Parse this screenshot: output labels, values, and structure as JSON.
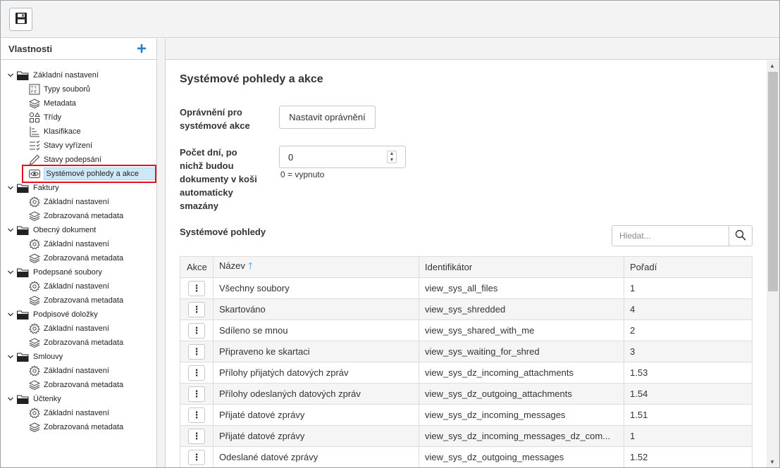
{
  "sidebar": {
    "title": "Vlastnosti",
    "groups": [
      {
        "label": "Základní nastavení",
        "items": [
          {
            "label": "Typy souborů",
            "icon": "file-types-icon"
          },
          {
            "label": "Metadata",
            "icon": "layers-icon"
          },
          {
            "label": "Třídy",
            "icon": "shapes-icon"
          },
          {
            "label": "Klasifikace",
            "icon": "classification-icon"
          },
          {
            "label": "Stavy vyřízení",
            "icon": "checklist-icon"
          },
          {
            "label": "Stavy podepsání",
            "icon": "pen-icon"
          },
          {
            "label": "Systémové pohledy a akce",
            "icon": "eye-icon",
            "selected": true
          }
        ]
      },
      {
        "label": "Faktury",
        "items": [
          {
            "label": "Základní nastavení",
            "icon": "gear-icon"
          },
          {
            "label": "Zobrazovaná metadata",
            "icon": "layers-icon"
          }
        ]
      },
      {
        "label": "Obecný dokument",
        "items": [
          {
            "label": "Základní nastavení",
            "icon": "gear-icon"
          },
          {
            "label": "Zobrazovaná metadata",
            "icon": "layers-icon"
          }
        ]
      },
      {
        "label": "Podepsané soubory",
        "items": [
          {
            "label": "Základní nastavení",
            "icon": "gear-icon"
          },
          {
            "label": "Zobrazovaná metadata",
            "icon": "layers-icon"
          }
        ]
      },
      {
        "label": "Podpisové doložky",
        "items": [
          {
            "label": "Základní nastavení",
            "icon": "gear-icon"
          },
          {
            "label": "Zobrazovaná metadata",
            "icon": "layers-icon"
          }
        ]
      },
      {
        "label": "Smlouvy",
        "items": [
          {
            "label": "Základní nastavení",
            "icon": "gear-icon"
          },
          {
            "label": "Zobrazovaná metadata",
            "icon": "layers-icon"
          }
        ]
      },
      {
        "label": "Účtenky",
        "items": [
          {
            "label": "Základní nastavení",
            "icon": "gear-icon"
          },
          {
            "label": "Zobrazovaná metadata",
            "icon": "layers-icon"
          }
        ]
      }
    ]
  },
  "main": {
    "title": "Systémové pohledy a akce",
    "permissions_label_1": "Oprávnění pro",
    "permissions_label_2": "systémové akce",
    "permissions_button": "Nastavit oprávnění",
    "days_label_1": "Počet dní, po",
    "days_label_2": "nichž budou",
    "days_label_3": "dokumenty v koši",
    "days_label_4": "automaticky",
    "days_label_5": "smazány",
    "days_value": "0",
    "days_hint": "0 = vypnuto",
    "section_title": "Systémové pohledy",
    "search_placeholder": "Hledat...",
    "table": {
      "headers": [
        "Akce",
        "Název",
        "Identifikátor",
        "Pořadí"
      ],
      "rows": [
        {
          "name": "Všechny soubory",
          "id": "view_sys_all_files",
          "order": "1"
        },
        {
          "name": "Skartováno",
          "id": "view_sys_shredded",
          "order": "4"
        },
        {
          "name": "Sdíleno se mnou",
          "id": "view_sys_shared_with_me",
          "order": "2"
        },
        {
          "name": "Připraveno ke skartaci",
          "id": "view_sys_waiting_for_shred",
          "order": "3"
        },
        {
          "name": "Přílohy přijatých datových zpráv",
          "id": "view_sys_dz_incoming_attachments",
          "order": "1.53"
        },
        {
          "name": "Přílohy odeslaných datových zpráv",
          "id": "view_sys_dz_outgoing_attachments",
          "order": "1.54"
        },
        {
          "name": "Přijaté datové zprávy",
          "id": "view_sys_dz_incoming_messages",
          "order": "1.51"
        },
        {
          "name": "Přijaté datové zprávy",
          "id": "view_sys_dz_incoming_messages_dz_com...",
          "order": "1"
        },
        {
          "name": "Odeslané datové zprávy",
          "id": "view_sys_dz_outgoing_messages",
          "order": "1.52"
        }
      ]
    }
  },
  "colors": {
    "accent": "#2a7ec8",
    "selection": "#cfe8f7",
    "highlight_box": "#e8101a"
  }
}
